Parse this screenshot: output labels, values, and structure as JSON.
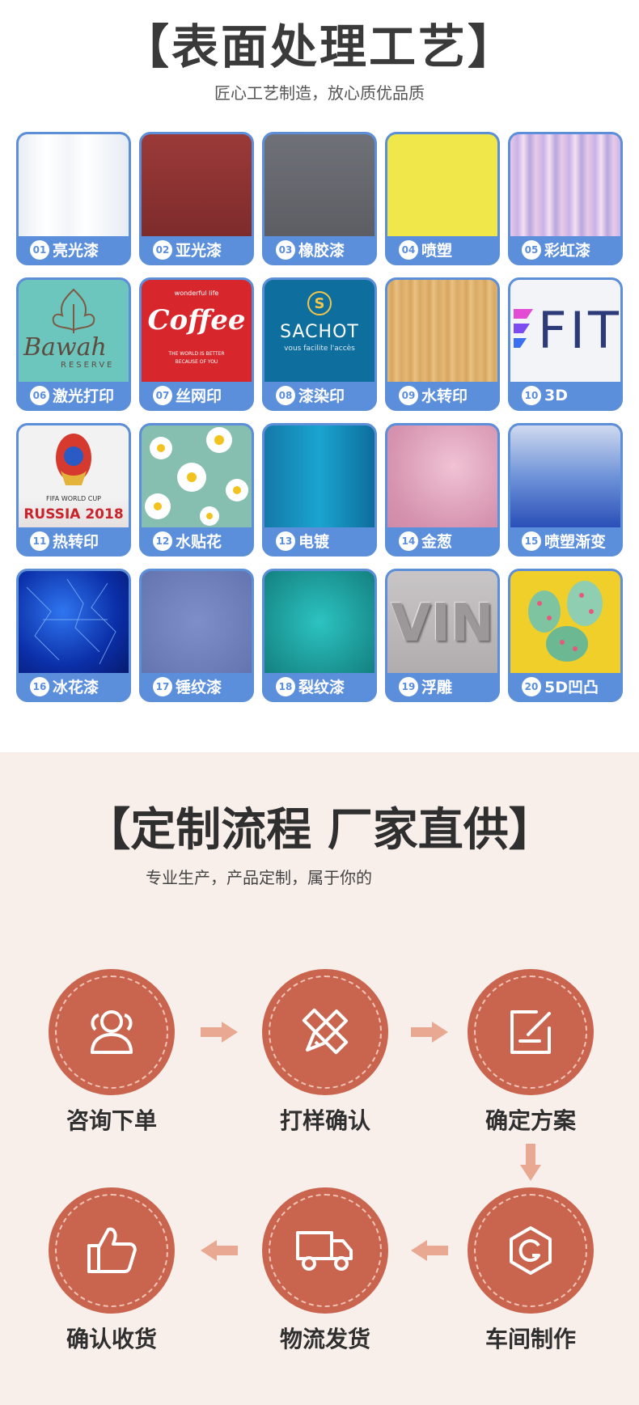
{
  "section1": {
    "title": "【表面处理工艺】",
    "subtitle": "匠心工艺制造，放心质优品质",
    "items": [
      {
        "num": "01",
        "name": "亮光漆"
      },
      {
        "num": "02",
        "name": "亚光漆"
      },
      {
        "num": "03",
        "name": "橡胶漆"
      },
      {
        "num": "04",
        "name": "喷塑"
      },
      {
        "num": "05",
        "name": "彩虹漆"
      },
      {
        "num": "06",
        "name": "激光打印"
      },
      {
        "num": "07",
        "name": "丝网印"
      },
      {
        "num": "08",
        "name": "漆染印"
      },
      {
        "num": "09",
        "name": "水转印"
      },
      {
        "num": "10",
        "name": "3D"
      },
      {
        "num": "11",
        "name": "热转印"
      },
      {
        "num": "12",
        "name": "水贴花"
      },
      {
        "num": "13",
        "name": "电镀"
      },
      {
        "num": "14",
        "name": "金葱"
      },
      {
        "num": "15",
        "name": "喷塑渐变"
      },
      {
        "num": "16",
        "name": "冰花漆"
      },
      {
        "num": "17",
        "name": "锤纹漆"
      },
      {
        "num": "18",
        "name": "裂纹漆"
      },
      {
        "num": "19",
        "name": "浮雕"
      },
      {
        "num": "20",
        "name": "5D凹凸"
      }
    ],
    "swatch_text": {
      "bawah": "Bawah",
      "reserve": "RESERVE",
      "coffee": "Coffee",
      "wonderful": "wonderful life",
      "better": "THE WORLD IS BETTER",
      "because": "BECAUSE OF YOU",
      "sachot_s": "S",
      "sachot": "SACHOT",
      "sachot_tag": "vous facilite l'accès",
      "fit": "FIT",
      "fifa": "FIFA WORLD CUP",
      "russia": "RUSSIA 2018",
      "vin": "VIN"
    }
  },
  "section2": {
    "title": "【定制流程 厂家直供】",
    "subtitle": "专业生产，产品定制，属于你的",
    "steps": [
      {
        "label": "咨询下单",
        "icon": "users-icon"
      },
      {
        "label": "打样确认",
        "icon": "pencil-ruler-icon"
      },
      {
        "label": "确定方案",
        "icon": "edit-note-icon"
      },
      {
        "label": "车间制作",
        "icon": "hexagon-gear-icon"
      },
      {
        "label": "物流发货",
        "icon": "truck-icon"
      },
      {
        "label": "确认收货",
        "icon": "thumbs-up-icon"
      }
    ]
  },
  "colors": {
    "card_blue": "#5b8edb",
    "circle": "#c9654f",
    "section2_bg": "#f8efeb",
    "arrow": "#e9a892"
  }
}
